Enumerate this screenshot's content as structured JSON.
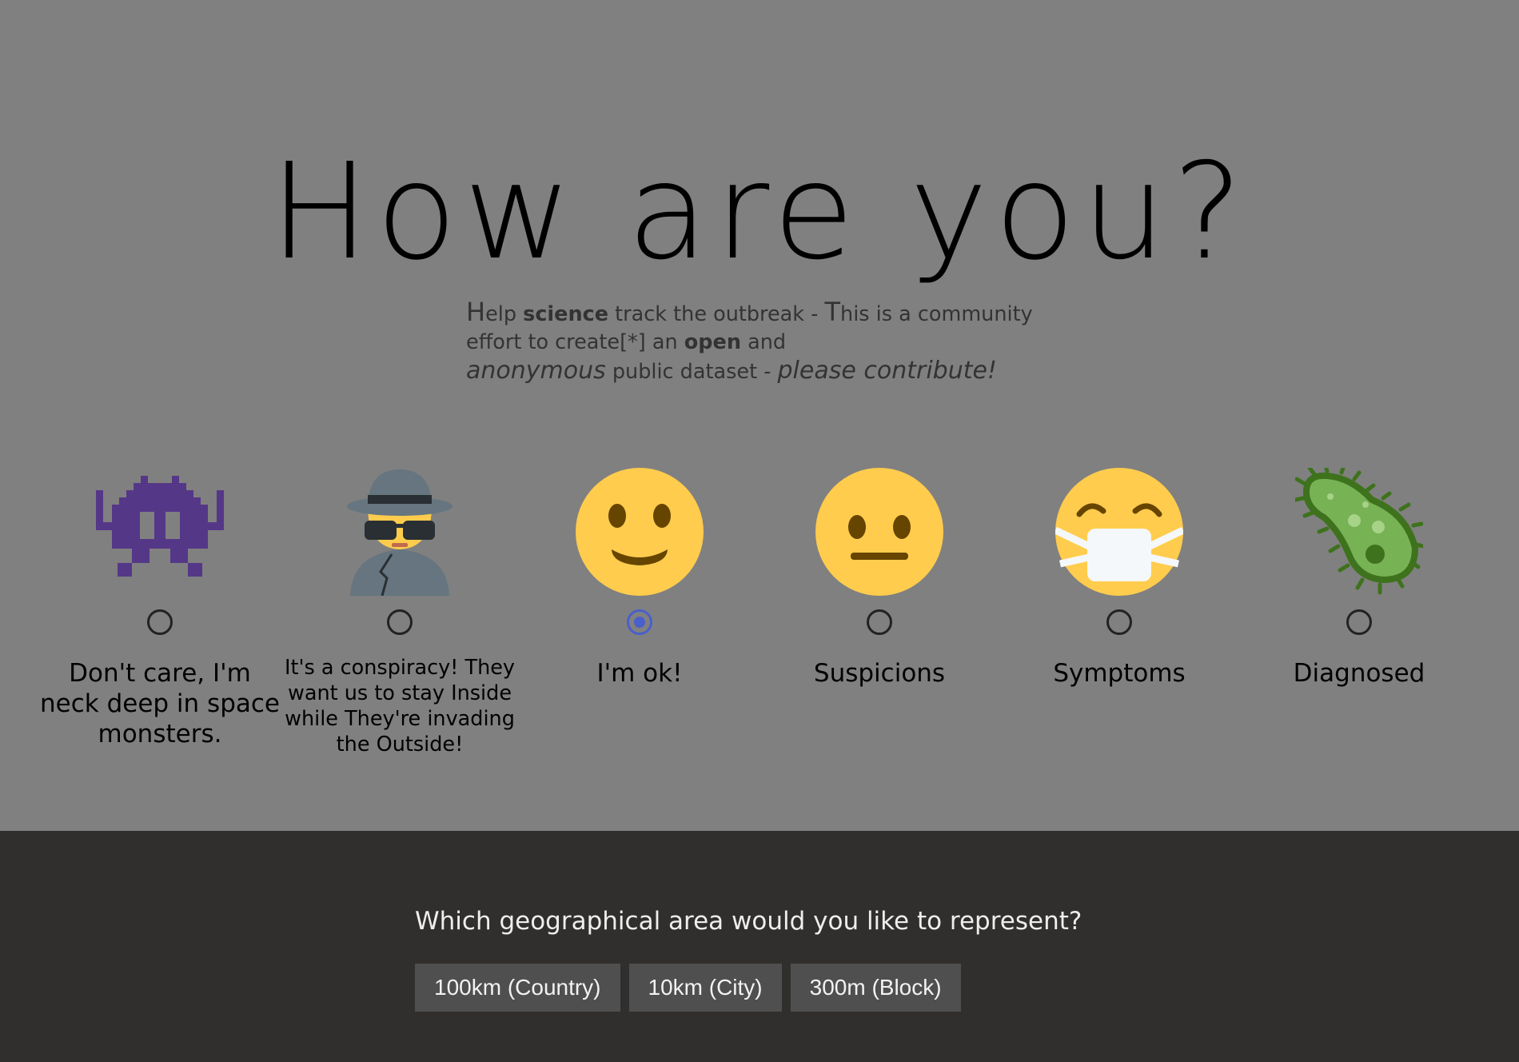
{
  "header": {
    "title": "How are you?",
    "subtitle": {
      "help_cap": "H",
      "help_rest": "elp ",
      "science": "science",
      "track": " track the outbreak - ",
      "this_cap": "T",
      "this_rest": "his is a community effort to create[*] an ",
      "open": "open",
      "and": " and",
      "anonymous": "anonymous",
      "public": " public dataset - ",
      "please": "please contribute!"
    }
  },
  "status_options": [
    {
      "id": "space-monsters",
      "label": "Don't care, I'm neck deep in space monsters.",
      "icon": "alien-monster-icon",
      "selected": false
    },
    {
      "id": "conspiracy",
      "label": "It's a conspiracy! They want us to stay Inside while They're invading the Outside!",
      "icon": "detective-icon",
      "selected": false
    },
    {
      "id": "ok",
      "label": "I'm ok!",
      "icon": "slightly-smiling-face-icon",
      "selected": true
    },
    {
      "id": "suspicions",
      "label": "Suspicions",
      "icon": "neutral-face-icon",
      "selected": false
    },
    {
      "id": "symptoms",
      "label": "Symptoms",
      "icon": "face-with-medical-mask-icon",
      "selected": false
    },
    {
      "id": "diagnosed",
      "label": "Diagnosed",
      "icon": "microbe-icon",
      "selected": false
    }
  ],
  "geo": {
    "question": "Which geographical area would you like to represent?",
    "buttons": [
      {
        "label": "100km (Country)"
      },
      {
        "label": "10km (City)"
      },
      {
        "label": "300m (Block)"
      }
    ]
  },
  "colors": {
    "page_background": "#808080",
    "footer_background": "#302f2d",
    "button_background": "#4f4f4f",
    "radio_selected": "#4a5fcb"
  }
}
